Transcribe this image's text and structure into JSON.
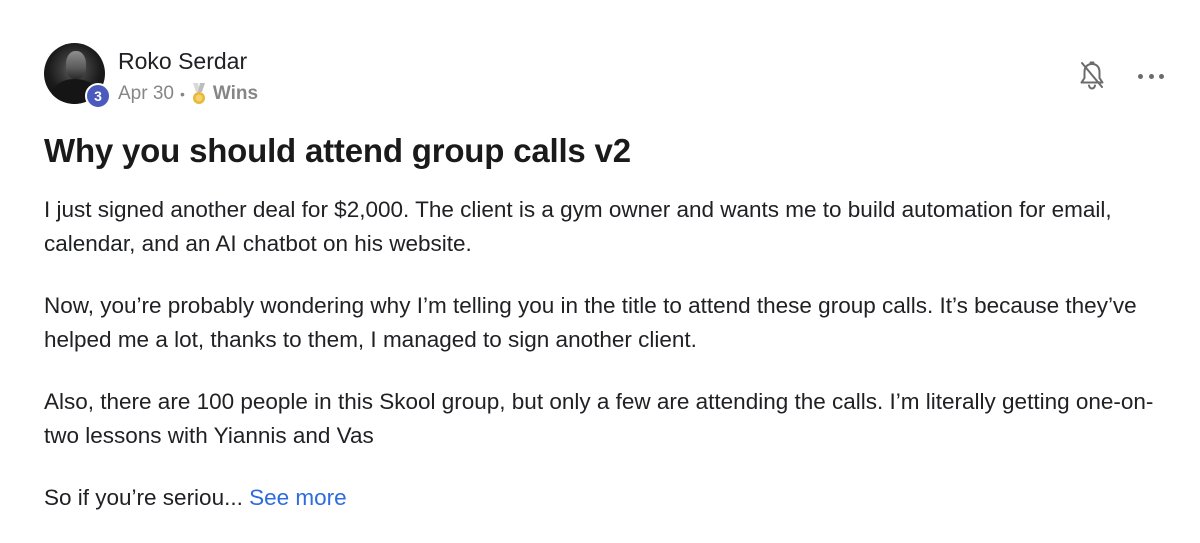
{
  "post": {
    "author": {
      "name": "Roko Serdar",
      "level": "3",
      "avatar_icon": "user-photo"
    },
    "meta": {
      "date": "Apr 30",
      "separator": "•",
      "category_icon": "medal-icon",
      "category": "Wins"
    },
    "actions": {
      "bell_icon": "bell-off-icon",
      "more_icon": "more-horizontal-icon"
    },
    "title": "Why you should attend group calls v2",
    "paragraphs": [
      "I just signed another deal for $2,000. The client is a gym owner and wants me to build automation for email, calendar, and an AI chatbot on his website.",
      "Now, you’re probably wondering why I’m telling you in the title to attend these group calls. It’s because they’ve helped me a lot, thanks to them, I managed to sign another client.",
      "Also, there are 100 people in this Skool group, but only a few are attending the calls. I’m literally getting one-on-two lessons with Yiannis and Vas"
    ],
    "truncated_text": "So if you’re seriou...",
    "see_more_label": "See more"
  },
  "colors": {
    "accent_link": "#2d6cdf",
    "level_badge": "#4b5bbd",
    "muted_text": "#868686",
    "medal_gold": "#e7b93a",
    "medal_ribbon": "#d9d9d9"
  }
}
